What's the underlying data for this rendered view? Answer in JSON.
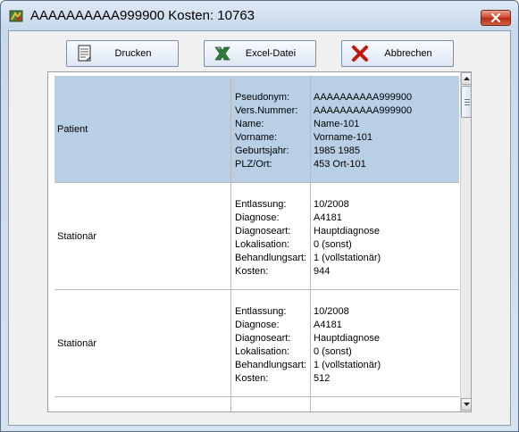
{
  "window": {
    "title": "AAAAAAAAAA999900 Kosten: 10763",
    "app_icon": "application-icon",
    "close_icon": "close-icon"
  },
  "toolbar": {
    "print": {
      "label": "Drucken",
      "icon": "print-document-icon"
    },
    "excel": {
      "label": "Excel-Datei",
      "icon": "excel-icon"
    },
    "cancel": {
      "label": "Abbrechen",
      "icon": "cancel-x-icon"
    }
  },
  "table": {
    "rows": [
      {
        "category": "Patient",
        "keys": [
          "Pseudonym:",
          "Vers.Nummer:",
          "Name:",
          "Vorname:",
          "Geburtsjahr:",
          "PLZ/Ort:"
        ],
        "values": [
          "AAAAAAAAAA999900",
          "AAAAAAAAAA999900",
          "Name-101",
          "Vorname-101",
          "1985 1985",
          "453 Ort-101"
        ]
      },
      {
        "category": "Stationär",
        "keys": [
          "Entlassung:",
          "Diagnose:",
          "Diagnoseart:",
          "Lokalisation:",
          "Behandlungsart:",
          "Kosten:"
        ],
        "values": [
          "10/2008",
          "A4181",
          "Hauptdiagnose",
          "0 (sonst)",
          "1 (vollstationär)",
          "944"
        ]
      },
      {
        "category": "Stationär",
        "keys": [
          "Entlassung:",
          "Diagnose:",
          "Diagnoseart:",
          "Lokalisation:",
          "Behandlungsart:",
          "Kosten:"
        ],
        "values": [
          "10/2008",
          "A4181",
          "Hauptdiagnose",
          "0 (sonst)",
          "1 (vollstationär)",
          "512"
        ]
      }
    ]
  },
  "colors": {
    "header_row": "#b8cfe6",
    "close_button": "#c9432a"
  }
}
